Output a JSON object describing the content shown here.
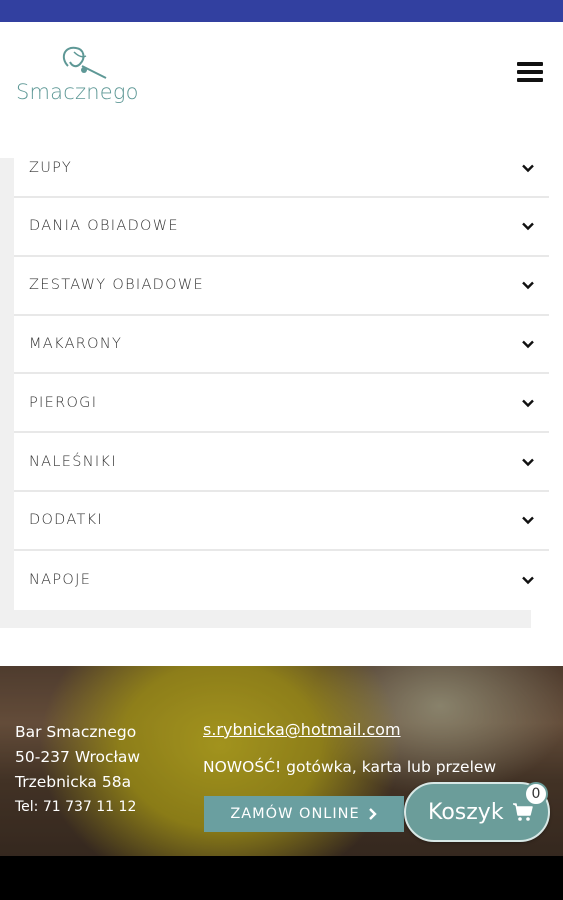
{
  "header": {
    "logo_text": "Smacznego",
    "menu_icon": "hamburger-menu-icon"
  },
  "categories": [
    {
      "label": "ZUPY"
    },
    {
      "label": "DANIA OBIADOWE"
    },
    {
      "label": "ZESTAWY OBIADOWE"
    },
    {
      "label": "MAKARONY"
    },
    {
      "label": "PIEROGI"
    },
    {
      "label": "NALEŚNIKI"
    },
    {
      "label": "DODATKI"
    },
    {
      "label": "NAPOJE"
    }
  ],
  "footer": {
    "name": "Bar Smacznego",
    "postal": "50-237 Wrocław",
    "street": "Trzebnicka 58a",
    "phone": "Tel: 71 737 11 12",
    "email": "s.rybnicka@hotmail.com",
    "news": "NOWOŚĆ! gotówka, karta lub przelew",
    "order_button": "ZAMÓW ONLINE"
  },
  "cart": {
    "label": "Koszyk",
    "count": "0"
  },
  "colors": {
    "status_bar": "#3240a0",
    "accent": "#6a9fa0",
    "logo": "#5e9896"
  }
}
